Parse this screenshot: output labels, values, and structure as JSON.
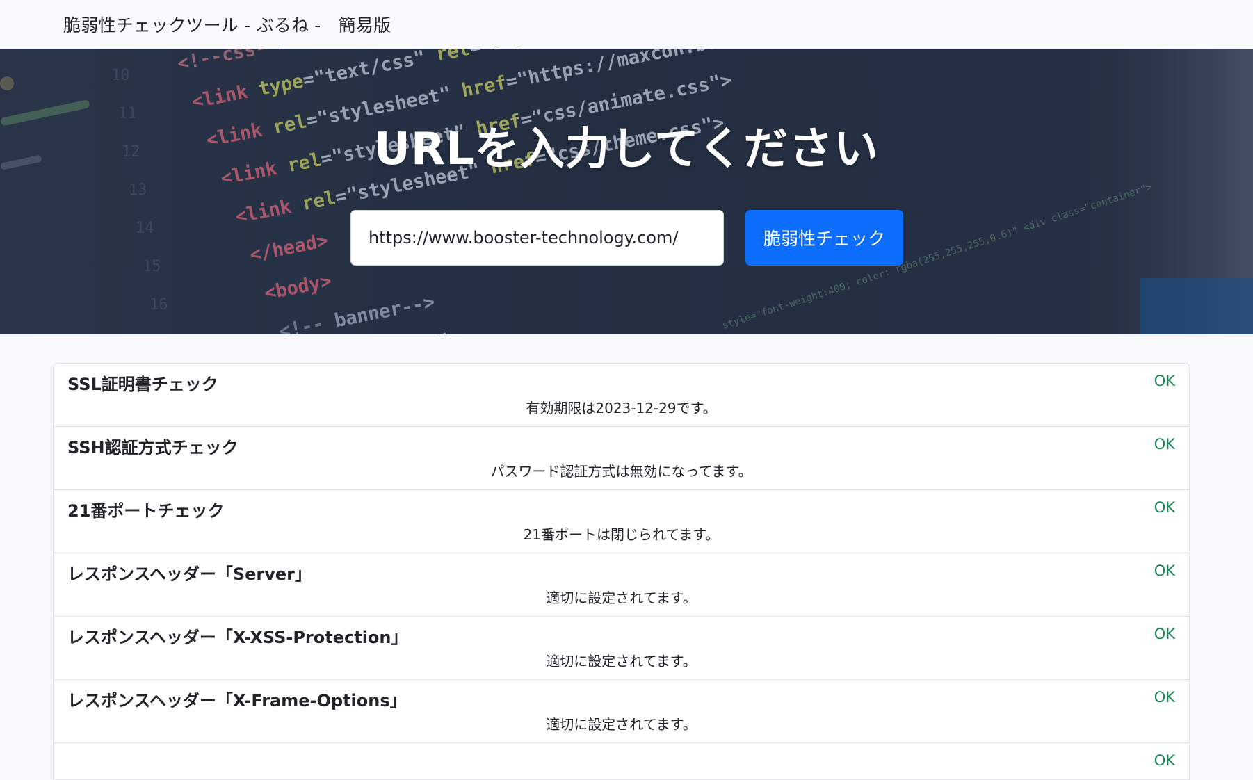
{
  "navbar": {
    "brand": "脆弱性チェックツール - ぶるね -　簡易版"
  },
  "hero": {
    "title": "URLを入力してください",
    "url_value": "https://www.booster-technology.com/",
    "button_label": "脆弱性チェック"
  },
  "results": [
    {
      "title": "SSL証明書チェック",
      "status": "OK",
      "description": "有効期限は2023-12-29です。"
    },
    {
      "title": "SSH認証方式チェック",
      "status": "OK",
      "description": "パスワード認証方式は無効になってます。"
    },
    {
      "title": "21番ポートチェック",
      "status": "OK",
      "description": "21番ポートは閉じられてます。"
    },
    {
      "title": "レスポンスヘッダー「Server」",
      "status": "OK",
      "description": "適切に設定されてます。"
    },
    {
      "title": "レスポンスヘッダー「X-XSS-Protection」",
      "status": "OK",
      "description": "適切に設定されてます。"
    },
    {
      "title": "レスポンスヘッダー「X-Frame-Options」",
      "status": "OK",
      "description": "適切に設定されてます。"
    },
    {
      "title": "",
      "status": "OK",
      "description": ""
    }
  ],
  "colors": {
    "status_ok": "#198754",
    "primary": "#0d6efd",
    "hero_background": "#2a3447"
  }
}
